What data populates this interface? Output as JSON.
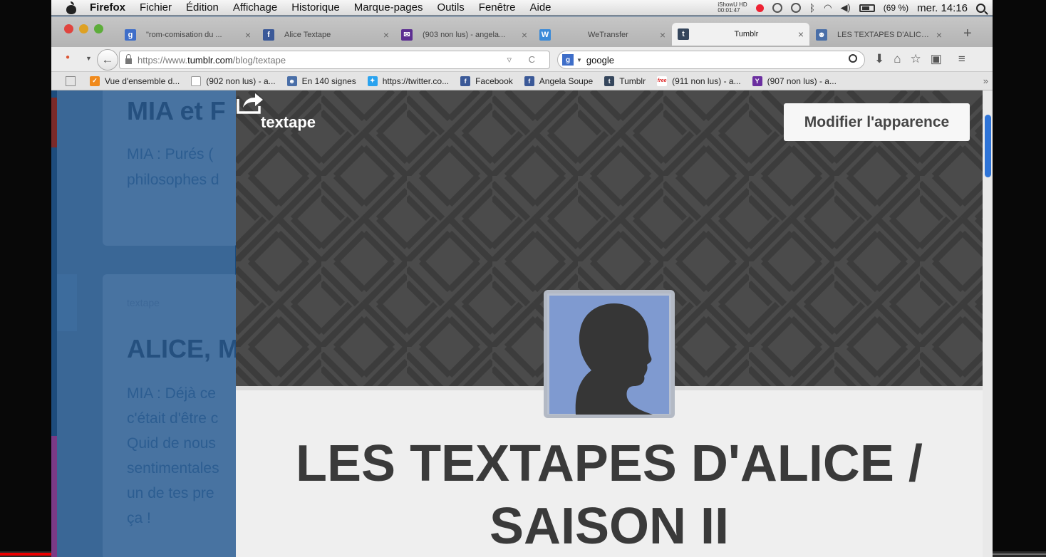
{
  "menubar": {
    "app": "Firefox",
    "items": [
      "Fichier",
      "Édition",
      "Affichage",
      "Historique",
      "Marque-pages",
      "Outils",
      "Fenêtre",
      "Aide"
    ],
    "ishow_label": "iShowU HD",
    "ishow_time": "00:01:47",
    "battery": "(69 %)",
    "clock": "mer. 14:16"
  },
  "tabs": [
    {
      "title": "\"rom-comisation du ...",
      "favicon": "google",
      "color": "#3f6ec9",
      "glyph": "g"
    },
    {
      "title": "Alice Textape",
      "favicon": "facebook",
      "color": "#3b5998",
      "glyph": "f"
    },
    {
      "title": "(903 non lus) - angela...",
      "favicon": "yahoo-mail",
      "color": "#5c2d91",
      "glyph": "✉"
    },
    {
      "title": "WeTransfer",
      "favicon": "wetransfer",
      "color": "#3a8ad8",
      "glyph": "W"
    },
    {
      "title": "Tumblr",
      "favicon": "tumblr",
      "color": "#35465c",
      "glyph": "t"
    },
    {
      "title": "LES TEXTAPES D'ALICE...",
      "favicon": "bust",
      "color": "#4a6fa8",
      "glyph": "☻"
    }
  ],
  "nav": {
    "url_prefix": "https://www.",
    "url_host": "tumblr.com",
    "url_path": "/blog/textape",
    "search_value": "google"
  },
  "bookmarks": [
    {
      "label": "Vue d'ensemble d...",
      "color": "#f08a1c",
      "glyph": "✓"
    },
    {
      "label": "(902 non lus) - a...",
      "color": "#ffffff",
      "glyph": ""
    },
    {
      "label": "En 140 signes",
      "color": "#4a6fa8",
      "glyph": "☻"
    },
    {
      "label": "https://twitter.co...",
      "color": "#2aa3ef",
      "glyph": "✦"
    },
    {
      "label": "Facebook",
      "color": "#3b5998",
      "glyph": "f"
    },
    {
      "label": "Angela Soupe",
      "color": "#3b5998",
      "glyph": "f"
    },
    {
      "label": "Tumblr",
      "color": "#35465c",
      "glyph": "t"
    },
    {
      "label": "(911 non lus) - a...",
      "color": "#ffffff",
      "glyph": "free"
    },
    {
      "label": "(907 non lus) - a...",
      "color": "#6b2fa0",
      "glyph": "Y"
    }
  ],
  "background_dashboard": {
    "post1_title": "MIA et F",
    "post1_line1": "MIA : Purés (",
    "post1_line2": "philosophes d",
    "post2_small": "textape",
    "post2_title": "ALICE, M",
    "post2_lines": [
      "MIA : Déjà ce",
      "c'était d'être c",
      "Quid de nous",
      "sentimentales",
      "un de tes pre",
      "ça !"
    ]
  },
  "blog": {
    "name": "textape",
    "customize_button": "Modifier l'apparence",
    "title_line1": "LES TEXTAPES D'ALICE /",
    "title_line2": "SAISON II"
  },
  "colors": {
    "accent_scroll": "#2e74d8",
    "dashboard_blue": "#1d4c7d"
  }
}
